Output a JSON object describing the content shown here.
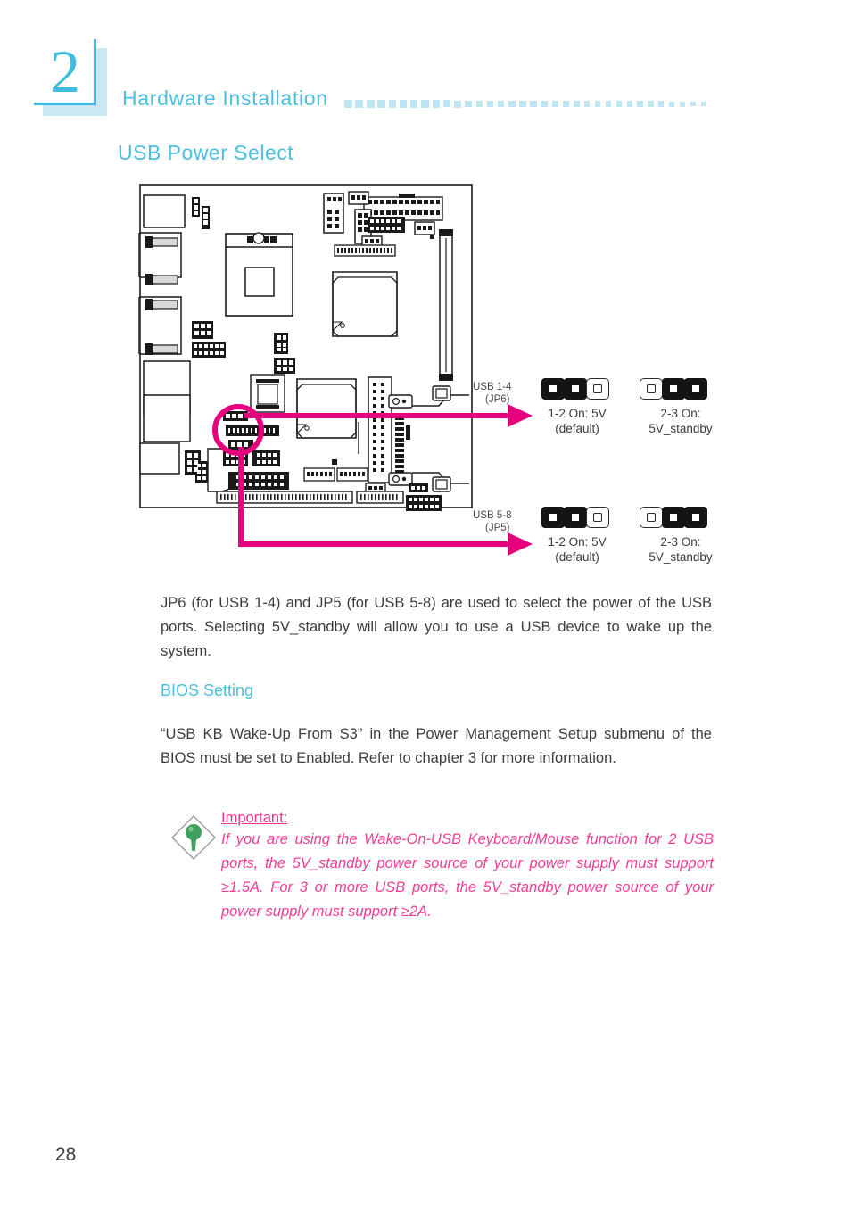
{
  "header": {
    "chapter_number": "2",
    "chapter_title": "Hardware  Installation",
    "dots_count": 34
  },
  "section": {
    "title": "USB Power Select"
  },
  "figure": {
    "jumpers": [
      {
        "id": "jp6",
        "name_line1": "USB  1-4",
        "name_line2": "(JP6)",
        "options": [
          {
            "pins": [
              "on",
              "on",
              "off"
            ],
            "caption_line1": "1-2  On: 5V",
            "caption_line2": "(default)"
          },
          {
            "pins": [
              "off",
              "on",
              "on"
            ],
            "caption_line1": "2-3  On:",
            "caption_line2": "5V_standby"
          }
        ]
      },
      {
        "id": "jp5",
        "name_line1": "USB  5-8",
        "name_line2": "(JP5)",
        "options": [
          {
            "pins": [
              "on",
              "on",
              "off"
            ],
            "caption_line1": "1-2  On: 5V",
            "caption_line2": "(default)"
          },
          {
            "pins": [
              "off",
              "on",
              "on"
            ],
            "caption_line1": "2-3  On:",
            "caption_line2": "5V_standby"
          }
        ]
      }
    ]
  },
  "body": {
    "paragraph_1": "JP6 (for USB 1-4) and JP5 (for USB 5-8) are used to select the power of the USB ports. Selecting 5V_standby will allow you to use a USB device to wake up the system.",
    "subhead_bios": "BIOS Setting",
    "paragraph_2": "“USB KB Wake-Up From S3” in the Power Management Setup submenu of the BIOS must be set to Enabled. Refer to chapter 3 for more information."
  },
  "callout": {
    "title": "Important:",
    "text": "If you are using the Wake-On-USB Keyboard/Mouse function for 2 USB ports, the 5V_standby power source of your power supply must support ≥1.5A. For 3 or more USB ports, the 5V_standby power source of your power supply must support ≥2A."
  },
  "footer": {
    "page_number": "28"
  },
  "colors": {
    "accent_cyan": "#4bbfe0",
    "accent_cyan_light": "#bfe4f2",
    "highlight_magenta": "#e6007e",
    "callout_pink": "#ef3e96",
    "icon_green": "#3fa060"
  }
}
